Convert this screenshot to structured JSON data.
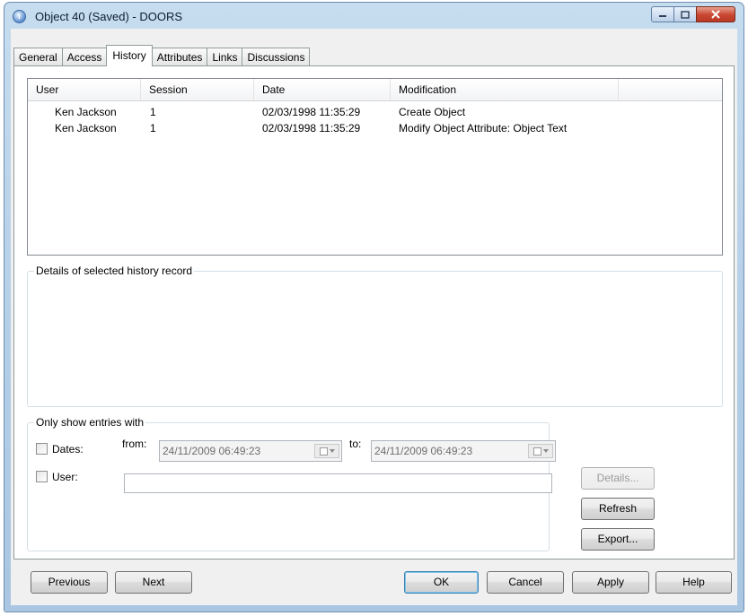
{
  "window": {
    "title": "Object 40 (Saved) - DOORS",
    "icon": "info-icon",
    "controls": {
      "minimize": "minimize-icon",
      "maximize": "maximize-icon",
      "close": "close-icon"
    }
  },
  "tabs": [
    {
      "label": "General"
    },
    {
      "label": "Access"
    },
    {
      "label": "History",
      "active": true
    },
    {
      "label": "Attributes"
    },
    {
      "label": "Links"
    },
    {
      "label": "Discussions"
    }
  ],
  "history": {
    "columns": [
      "User",
      "Session",
      "Date",
      "Modification"
    ],
    "rows": [
      [
        "Ken Jackson",
        "1",
        "02/03/1998 11:35:29",
        "Create Object"
      ],
      [
        "Ken Jackson",
        "1",
        "02/03/1998 11:35:29",
        "Modify Object Attribute: Object Text"
      ]
    ]
  },
  "details": {
    "label": "Details of selected history record"
  },
  "filter": {
    "label": "Only show entries with",
    "dates_label": "Dates:",
    "from_label": "from:",
    "from_value": "24/11/2009 06:49:23",
    "to_label": "to:",
    "to_value": "24/11/2009 06:49:23",
    "user_label": "User:",
    "user_value": ""
  },
  "side_buttons": {
    "details": "Details...",
    "refresh": "Refresh",
    "export": "Export..."
  },
  "footer": {
    "previous": "Previous",
    "next": "Next",
    "ok": "OK",
    "cancel": "Cancel",
    "apply": "Apply",
    "help": "Help"
  }
}
